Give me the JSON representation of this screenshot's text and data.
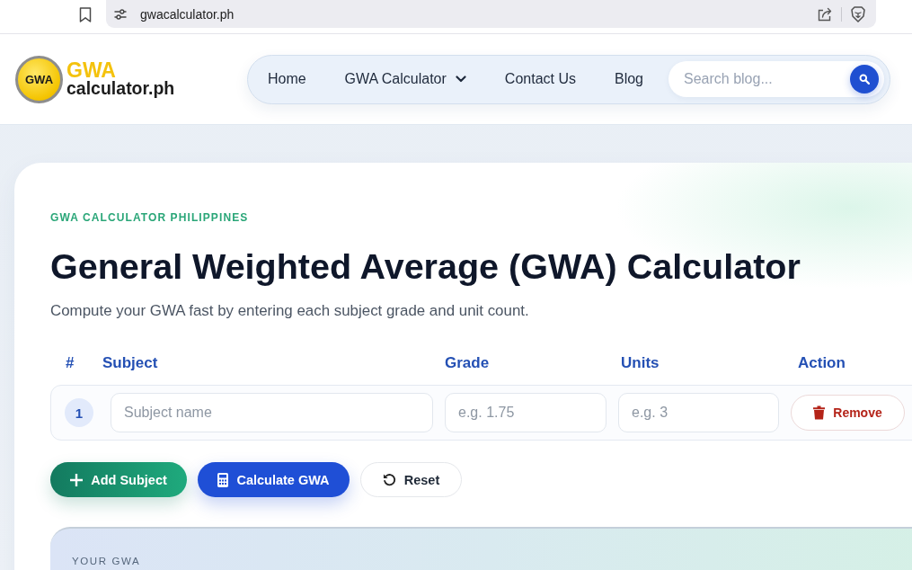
{
  "browser": {
    "address": "gwacalculator.ph"
  },
  "header": {
    "logo": {
      "badge": "GWA",
      "name": "GWA",
      "domain": "calculator.ph"
    },
    "nav": [
      {
        "label": "Home",
        "kind": "link"
      },
      {
        "label": "GWA Calculator",
        "kind": "dropdown"
      },
      {
        "label": "Contact Us",
        "kind": "link"
      },
      {
        "label": "Blog",
        "kind": "link"
      }
    ],
    "search": {
      "placeholder": "Search blog..."
    }
  },
  "calculator": {
    "eyebrow": "GWA CALCULATOR PHILIPPINES",
    "title": "General Weighted Average (GWA) Calculator",
    "subtitle": "Compute your GWA fast by entering each subject grade and unit count.",
    "table": {
      "columns": [
        "#",
        "Subject",
        "Grade",
        "Units",
        "Action"
      ],
      "rows": [
        {
          "number": "1",
          "subject": {
            "placeholder": "Subject name"
          },
          "grade": {
            "placeholder": "e.g. 1.75"
          },
          "units": {
            "placeholder": "e.g. 3"
          },
          "action": "Remove"
        }
      ]
    },
    "buttons": [
      {
        "label": "Add Subject",
        "kind": "add"
      },
      {
        "label": "Calculate GWA",
        "kind": "calculate"
      },
      {
        "label": "Reset",
        "kind": "reset"
      }
    ],
    "result": {
      "label": "YOUR GWA"
    }
  }
}
